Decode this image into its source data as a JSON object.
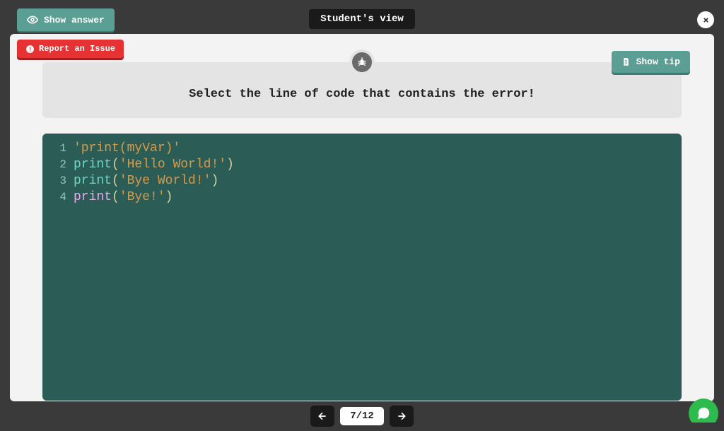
{
  "header": {
    "show_answer": "Show answer",
    "title": "Student's view"
  },
  "actions": {
    "report_issue": "Report an Issue",
    "show_tip": "Show tip"
  },
  "prompt": "Select the line of code that contains the error!",
  "code_lines": [
    {
      "n": "1",
      "tokens": [
        {
          "t": "str",
          "v": "'print(myVar)'"
        }
      ]
    },
    {
      "n": "2",
      "tokens": [
        {
          "t": "fn",
          "v": "print"
        },
        {
          "t": "punc",
          "v": "("
        },
        {
          "t": "str",
          "v": "'Hello World!'"
        },
        {
          "t": "punc",
          "v": ")"
        }
      ]
    },
    {
      "n": "3",
      "tokens": [
        {
          "t": "fn",
          "v": "print"
        },
        {
          "t": "punc",
          "v": "("
        },
        {
          "t": "str",
          "v": "'Bye World!'"
        },
        {
          "t": "punc",
          "v": ")"
        }
      ]
    },
    {
      "n": "4",
      "tokens": [
        {
          "t": "plain",
          "v": "print"
        },
        {
          "t": "punc",
          "v": "("
        },
        {
          "t": "str",
          "v": "'Bye!'"
        },
        {
          "t": "punc",
          "v": ")"
        }
      ]
    }
  ],
  "nav": {
    "page_label": "7/12"
  }
}
